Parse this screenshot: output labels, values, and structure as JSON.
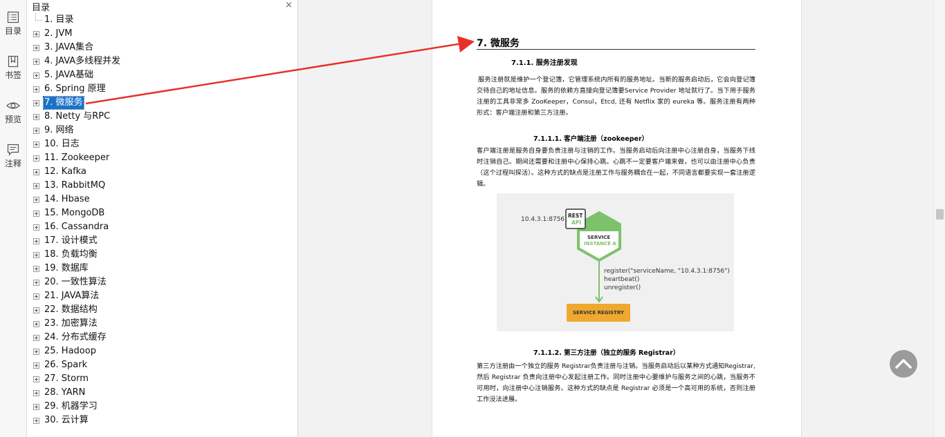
{
  "rail": {
    "items": [
      {
        "label": "目录",
        "icon": "list-icon"
      },
      {
        "label": "书签",
        "icon": "bookmark-icon"
      },
      {
        "label": "预览",
        "icon": "eye-icon"
      },
      {
        "label": "注释",
        "icon": "comment-icon"
      }
    ]
  },
  "toc": {
    "title": "目录",
    "close": "×",
    "items": [
      "1. 目录",
      "2. JVM",
      "3. JAVA集合",
      "4. JAVA多线程并发",
      "5. JAVA基础",
      "6. Spring 原理",
      "7. 微服务",
      "8. Netty 与RPC",
      "9. 网络",
      "10. 日志",
      "11. Zookeeper",
      "12. Kafka",
      "13. RabbitMQ",
      "14. Hbase",
      "15. MongoDB",
      "16. Cassandra",
      "17. 设计模式",
      "18. 负载均衡",
      "19. 数据库",
      "20. 一致性算法",
      "21. JAVA算法",
      "22. 数据结构",
      "23. 加密算法",
      "24. 分布式缓存",
      "25. Hadoop",
      "26. Spark",
      "27. Storm",
      "28. YARN",
      "29. 机器学习",
      "30. 云计算"
    ],
    "selected_index": 6
  },
  "doc": {
    "h1": "7.   微服务",
    "h2": "7.1.1.   服务注册发现",
    "p1": "服务注册就是维护一个登记簿，它管理系统内所有的服务地址。当新的服务启动后，它会向登记簿交待自己的地址信息。服务的依赖方直接向登记簿要Service Provider 地址就行了。当下用于服务注册的工具非常多 ZooKeeper，Consul，Etcd, 还有 Netflix 家的 eureka 等。服务注册有两种形式：客户端注册和第三方注册。",
    "h3a": "7.1.1.1.      客户端注册（zookeeper）",
    "p2": "客户端注册是服务自身要负责注册与注销的工作。当服务启动后向注册中心注册自身，当服务下线时注销自己。期间还需要和注册中心保持心跳。心跳不一定要客户端来做，也可以由注册中心负责（这个过程叫探活）。这种方式的缺点是注册工作与服务耦合在一起，不同语言都要实现一套注册逻辑。",
    "h3b": "7.1.1.2.      第三方注册（独立的服务 Registrar）",
    "p3": "第三方注册由一个独立的服务 Registrar负责注册与注销。当服务启动后以某种方式通知Registrar,然后 Registrar 负责向注册中心发起注册工作。同时注册中心要维护与服务之间的心跳，当服务不可用时，向注册中心注销服务。这种方式的缺点是 Registrar 必须是一个高可用的系统，否则注册工作没法进展。"
  },
  "figure": {
    "ip": "10.4.3.1:8756",
    "rest": "REST",
    "api": "API",
    "service": "SERVICE",
    "instance": "INSTANCE A",
    "call1": "register(\"serviceName, \"10.4.3.1:8756\")",
    "call2": "heartbeat()",
    "call3": "unregister()",
    "registry": "SERVICE REGISTRY",
    "colors": {
      "green": "#7cc26b",
      "orange": "#f0a830"
    }
  },
  "colors": {
    "selection": "#1a73c9",
    "arrow": "#e8302a"
  }
}
